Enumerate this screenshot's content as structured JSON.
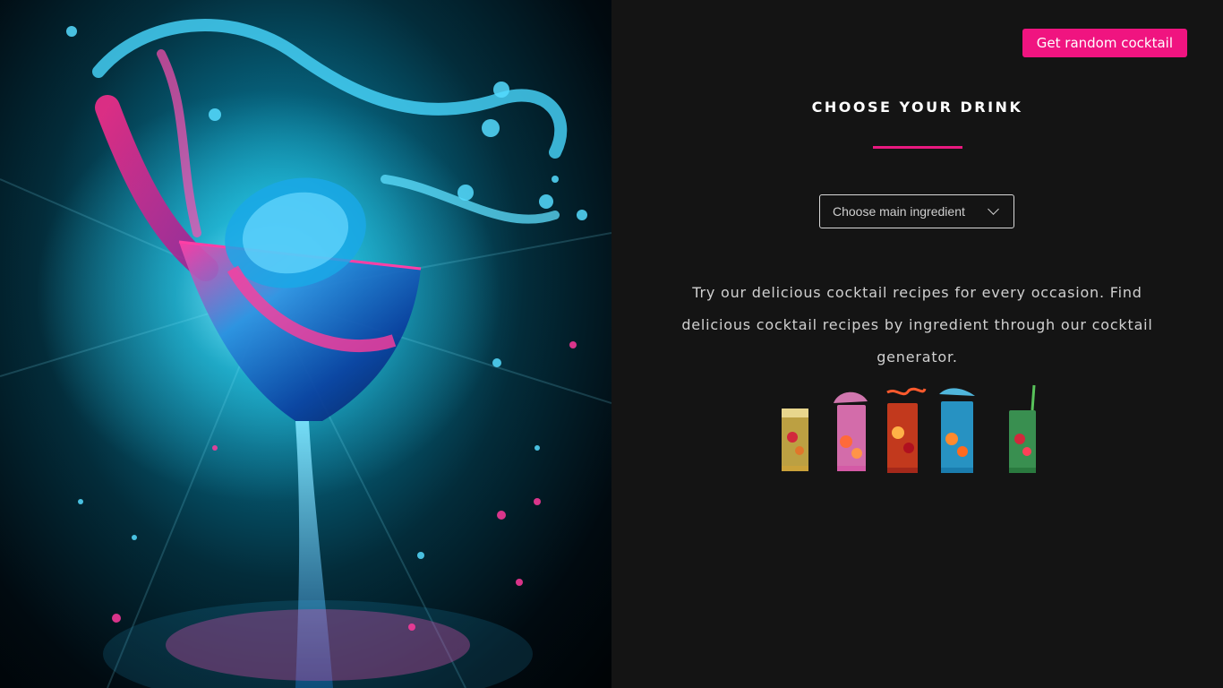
{
  "header": {
    "random_button_label": "Get random cocktail"
  },
  "main": {
    "title": "CHOOSE YOUR DRINK",
    "select": {
      "selected": "Choose main ingredient"
    },
    "description": "Try our delicious cocktail recipes for every occasion. Find delicious cocktail recipes by ingredient through our cocktail generator."
  },
  "colors": {
    "accent": "#f01480",
    "background": "#141414"
  },
  "icons": {
    "select_chevron": "chevron-down-icon"
  }
}
